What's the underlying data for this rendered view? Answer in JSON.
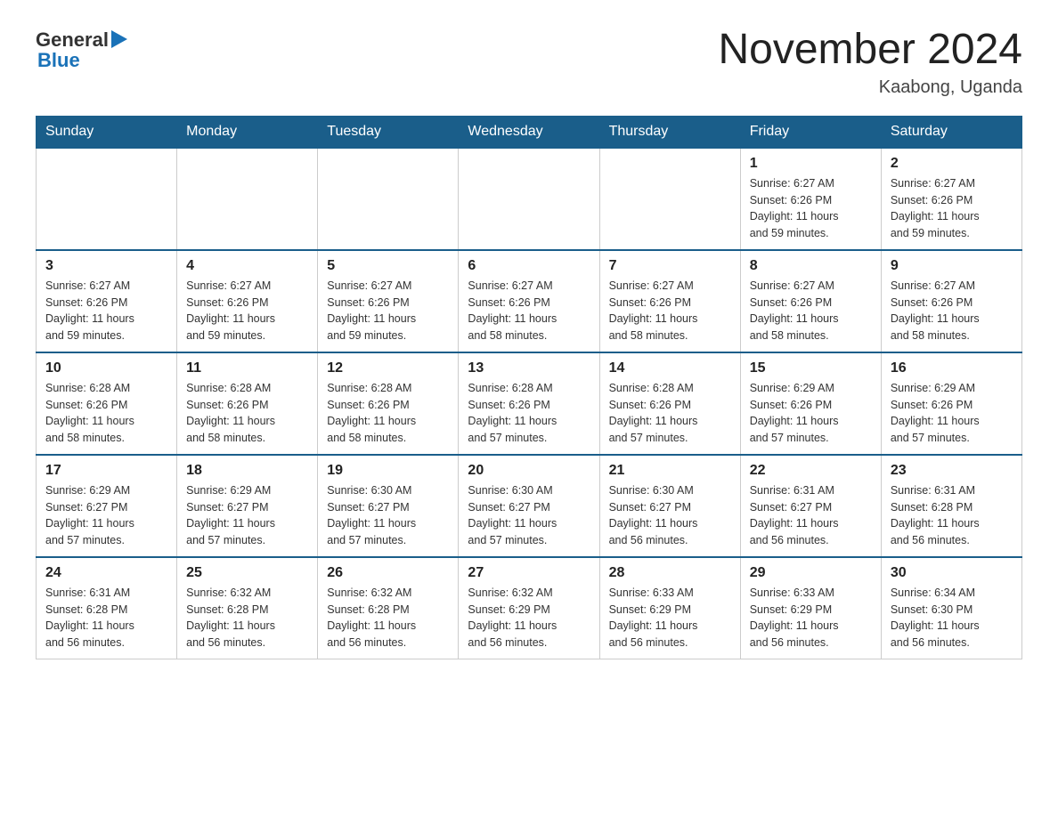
{
  "header": {
    "logo": {
      "general": "General",
      "arrow": "▶",
      "blue": "Blue"
    },
    "month_title": "November 2024",
    "location": "Kaabong, Uganda"
  },
  "weekdays": [
    "Sunday",
    "Monday",
    "Tuesday",
    "Wednesday",
    "Thursday",
    "Friday",
    "Saturday"
  ],
  "weeks": [
    [
      {
        "day": "",
        "info": ""
      },
      {
        "day": "",
        "info": ""
      },
      {
        "day": "",
        "info": ""
      },
      {
        "day": "",
        "info": ""
      },
      {
        "day": "",
        "info": ""
      },
      {
        "day": "1",
        "info": "Sunrise: 6:27 AM\nSunset: 6:26 PM\nDaylight: 11 hours\nand 59 minutes."
      },
      {
        "day": "2",
        "info": "Sunrise: 6:27 AM\nSunset: 6:26 PM\nDaylight: 11 hours\nand 59 minutes."
      }
    ],
    [
      {
        "day": "3",
        "info": "Sunrise: 6:27 AM\nSunset: 6:26 PM\nDaylight: 11 hours\nand 59 minutes."
      },
      {
        "day": "4",
        "info": "Sunrise: 6:27 AM\nSunset: 6:26 PM\nDaylight: 11 hours\nand 59 minutes."
      },
      {
        "day": "5",
        "info": "Sunrise: 6:27 AM\nSunset: 6:26 PM\nDaylight: 11 hours\nand 59 minutes."
      },
      {
        "day": "6",
        "info": "Sunrise: 6:27 AM\nSunset: 6:26 PM\nDaylight: 11 hours\nand 58 minutes."
      },
      {
        "day": "7",
        "info": "Sunrise: 6:27 AM\nSunset: 6:26 PM\nDaylight: 11 hours\nand 58 minutes."
      },
      {
        "day": "8",
        "info": "Sunrise: 6:27 AM\nSunset: 6:26 PM\nDaylight: 11 hours\nand 58 minutes."
      },
      {
        "day": "9",
        "info": "Sunrise: 6:27 AM\nSunset: 6:26 PM\nDaylight: 11 hours\nand 58 minutes."
      }
    ],
    [
      {
        "day": "10",
        "info": "Sunrise: 6:28 AM\nSunset: 6:26 PM\nDaylight: 11 hours\nand 58 minutes."
      },
      {
        "day": "11",
        "info": "Sunrise: 6:28 AM\nSunset: 6:26 PM\nDaylight: 11 hours\nand 58 minutes."
      },
      {
        "day": "12",
        "info": "Sunrise: 6:28 AM\nSunset: 6:26 PM\nDaylight: 11 hours\nand 58 minutes."
      },
      {
        "day": "13",
        "info": "Sunrise: 6:28 AM\nSunset: 6:26 PM\nDaylight: 11 hours\nand 57 minutes."
      },
      {
        "day": "14",
        "info": "Sunrise: 6:28 AM\nSunset: 6:26 PM\nDaylight: 11 hours\nand 57 minutes."
      },
      {
        "day": "15",
        "info": "Sunrise: 6:29 AM\nSunset: 6:26 PM\nDaylight: 11 hours\nand 57 minutes."
      },
      {
        "day": "16",
        "info": "Sunrise: 6:29 AM\nSunset: 6:26 PM\nDaylight: 11 hours\nand 57 minutes."
      }
    ],
    [
      {
        "day": "17",
        "info": "Sunrise: 6:29 AM\nSunset: 6:27 PM\nDaylight: 11 hours\nand 57 minutes."
      },
      {
        "day": "18",
        "info": "Sunrise: 6:29 AM\nSunset: 6:27 PM\nDaylight: 11 hours\nand 57 minutes."
      },
      {
        "day": "19",
        "info": "Sunrise: 6:30 AM\nSunset: 6:27 PM\nDaylight: 11 hours\nand 57 minutes."
      },
      {
        "day": "20",
        "info": "Sunrise: 6:30 AM\nSunset: 6:27 PM\nDaylight: 11 hours\nand 57 minutes."
      },
      {
        "day": "21",
        "info": "Sunrise: 6:30 AM\nSunset: 6:27 PM\nDaylight: 11 hours\nand 56 minutes."
      },
      {
        "day": "22",
        "info": "Sunrise: 6:31 AM\nSunset: 6:27 PM\nDaylight: 11 hours\nand 56 minutes."
      },
      {
        "day": "23",
        "info": "Sunrise: 6:31 AM\nSunset: 6:28 PM\nDaylight: 11 hours\nand 56 minutes."
      }
    ],
    [
      {
        "day": "24",
        "info": "Sunrise: 6:31 AM\nSunset: 6:28 PM\nDaylight: 11 hours\nand 56 minutes."
      },
      {
        "day": "25",
        "info": "Sunrise: 6:32 AM\nSunset: 6:28 PM\nDaylight: 11 hours\nand 56 minutes."
      },
      {
        "day": "26",
        "info": "Sunrise: 6:32 AM\nSunset: 6:28 PM\nDaylight: 11 hours\nand 56 minutes."
      },
      {
        "day": "27",
        "info": "Sunrise: 6:32 AM\nSunset: 6:29 PM\nDaylight: 11 hours\nand 56 minutes."
      },
      {
        "day": "28",
        "info": "Sunrise: 6:33 AM\nSunset: 6:29 PM\nDaylight: 11 hours\nand 56 minutes."
      },
      {
        "day": "29",
        "info": "Sunrise: 6:33 AM\nSunset: 6:29 PM\nDaylight: 11 hours\nand 56 minutes."
      },
      {
        "day": "30",
        "info": "Sunrise: 6:34 AM\nSunset: 6:30 PM\nDaylight: 11 hours\nand 56 minutes."
      }
    ]
  ]
}
